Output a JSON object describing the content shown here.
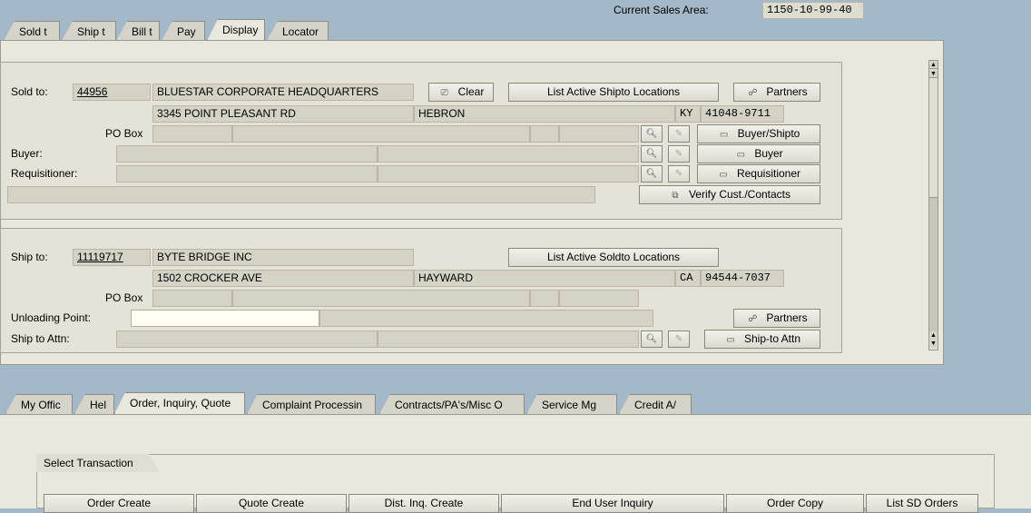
{
  "header": {
    "sales_area_label": "Current Sales Area:",
    "sales_area_value": "1150-10-99-40"
  },
  "top_tabs": [
    "Sold t",
    "Ship t",
    "Bill t",
    "Pay",
    "Display",
    "Locator"
  ],
  "sold_to": {
    "label": "Sold to:",
    "number": "44956",
    "name": "BLUESTAR  CORPORATE HEADQUARTERS",
    "clear_label": "Clear",
    "list_shipto_label": "List Active Shipto Locations",
    "partners_label": "Partners",
    "street": "3345 POINT PLEASANT RD",
    "city": "HEBRON",
    "state": "KY",
    "zip": "41048-9711",
    "po_box_label": "PO Box",
    "buyer_shipto_label": "Buyer/Shipto",
    "buyer_label": "Buyer:",
    "buyer_button": "Buyer",
    "requisitioner_label": "Requisitioner:",
    "requisitioner_button": "Requisitioner",
    "verify_label": "Verify Cust./Contacts"
  },
  "ship_to": {
    "label": "Ship to:",
    "number": "11119717",
    "name": "BYTE BRIDGE INC",
    "list_soldto_label": "List Active Soldto Locations",
    "street": "1502 CROCKER AVE",
    "city": "HAYWARD",
    "state": "CA",
    "zip": "94544-7037",
    "po_box_label": "PO Box",
    "unloading_label": "Unloading Point:",
    "unloading_value": "",
    "partners_label": "Partners",
    "attn_label": "Ship to Attn:",
    "attn_button": "Ship-to Attn"
  },
  "bottom_tabs": [
    "My Offic",
    "Hel",
    "Order, Inquiry, Quote",
    "Complaint Processin",
    "Contracts/PA's/Misc O",
    "Service Mg",
    "Credit A/"
  ],
  "transactions": {
    "group_label": "Select Transaction",
    "buttons": [
      "Order Create",
      "Quote Create",
      "Dist. Inq. Create",
      "End User Inquiry",
      "Order Copy",
      "List SD Orders"
    ]
  },
  "icons": {
    "binoculars": "binoculars-icon",
    "edit": "edit-icon",
    "document": "document-icon",
    "partners": "partners-icon",
    "clear": "clear-icon",
    "verify": "verify-icon"
  }
}
